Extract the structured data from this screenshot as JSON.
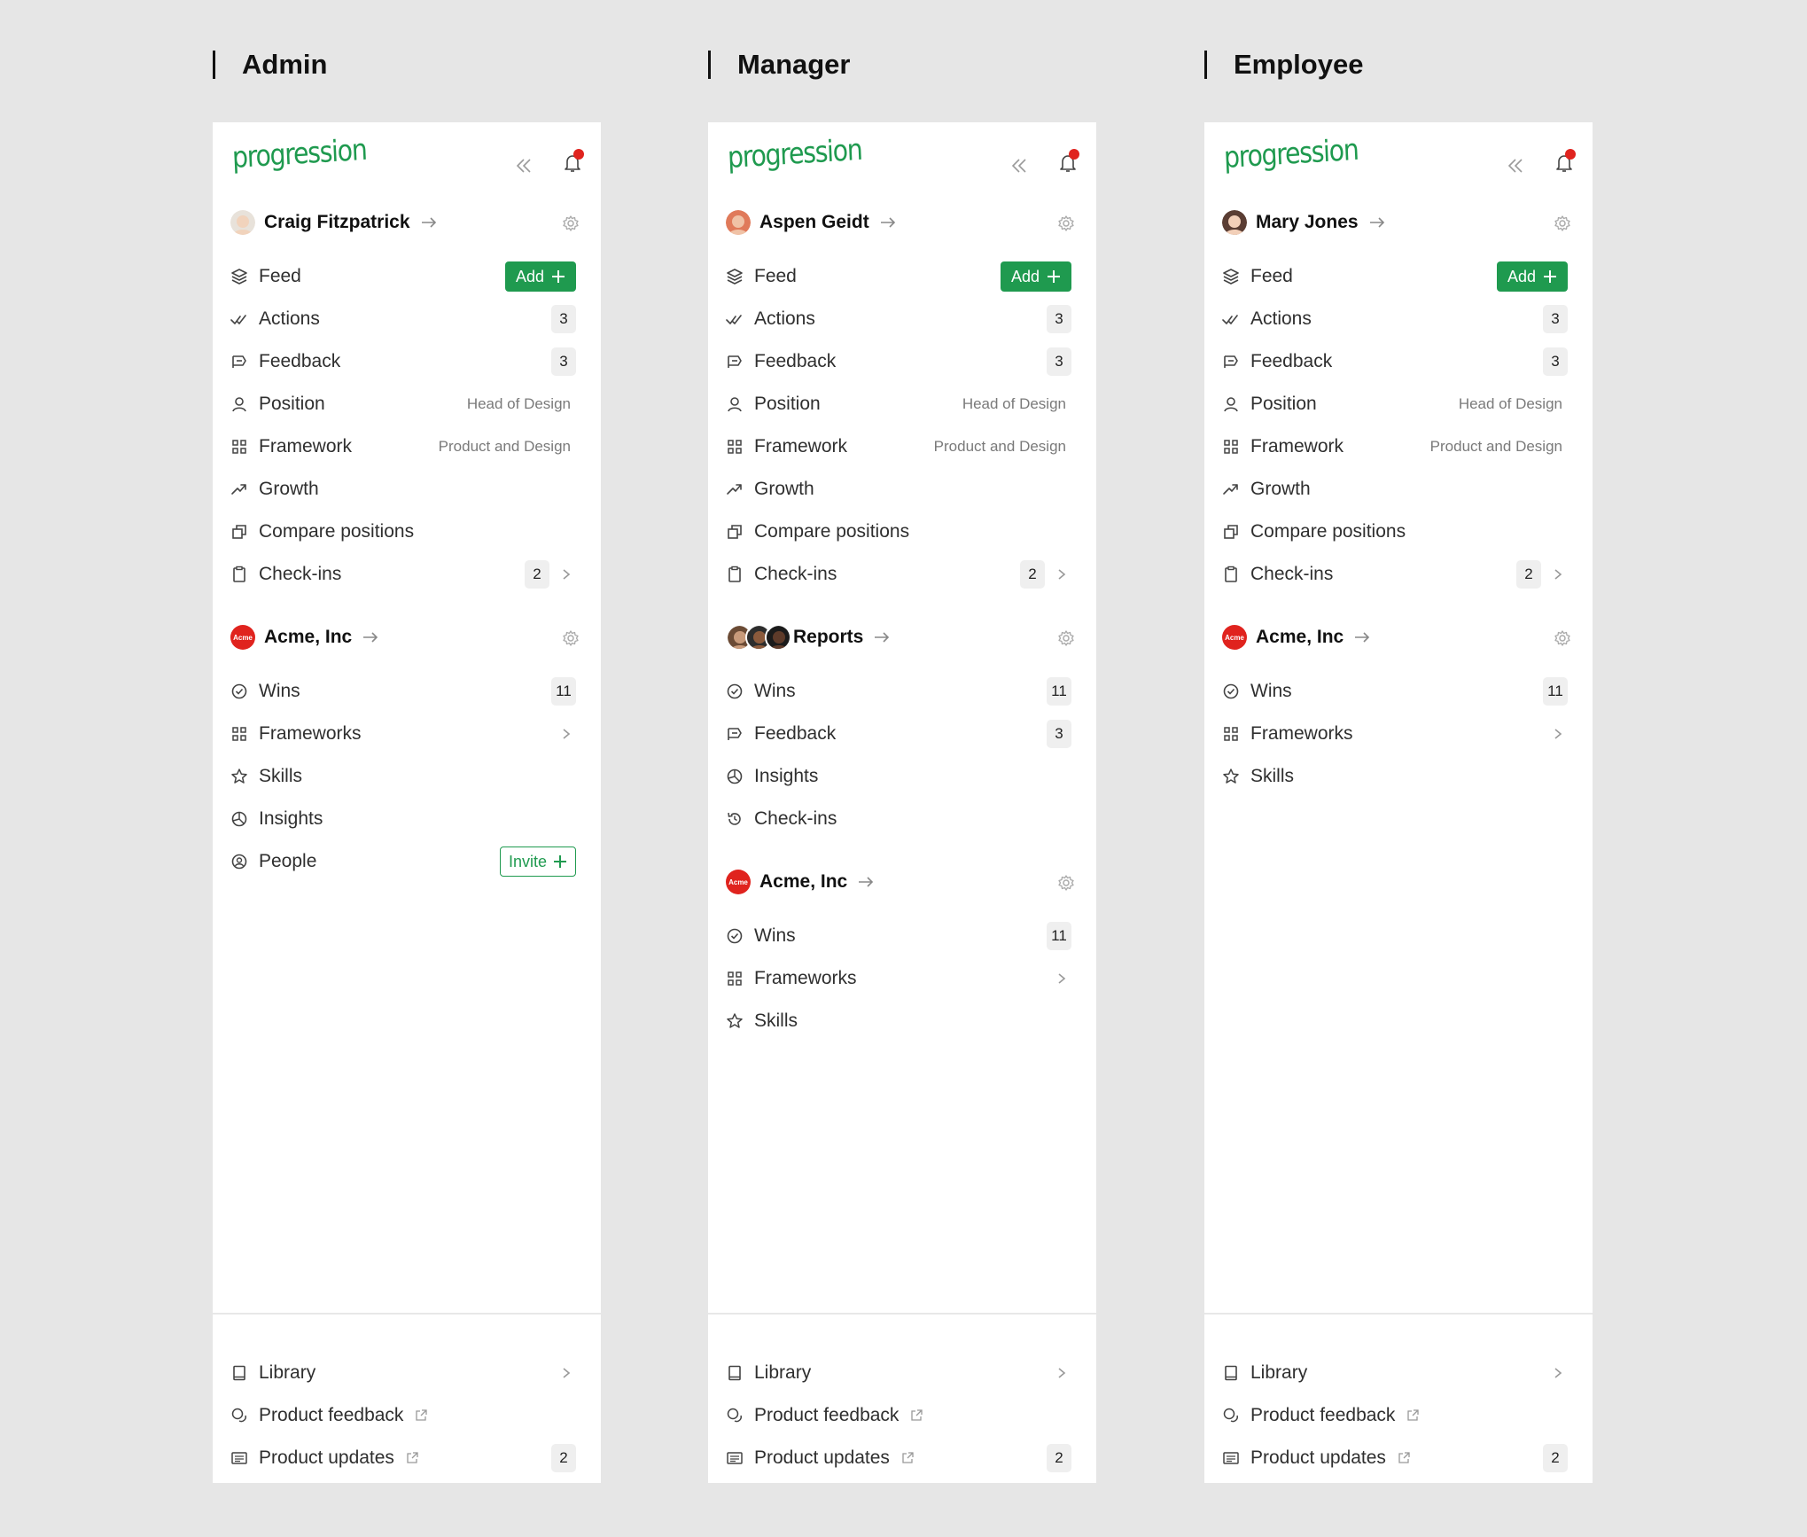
{
  "roles": [
    "Admin",
    "Manager",
    "Employee"
  ],
  "brand": {
    "logo_text": "progression",
    "accent": "#1f9a4f",
    "alert": "#e0231e"
  },
  "admin": {
    "user_name": "Craig Fitzpatrick",
    "top_items": [
      {
        "label": "Feed",
        "button": "Add"
      },
      {
        "label": "Actions",
        "badge": "3"
      },
      {
        "label": "Feedback",
        "badge": "3"
      },
      {
        "label": "Position",
        "meta": "Head of Design"
      },
      {
        "label": "Framework",
        "meta": "Product and Design"
      },
      {
        "label": "Growth"
      },
      {
        "label": "Compare positions"
      },
      {
        "label": "Check-ins",
        "badge": "2"
      }
    ],
    "org_name": "Acme, Inc",
    "org_logo_text": "Acme",
    "org_items": [
      {
        "label": "Wins",
        "badge": "11"
      },
      {
        "label": "Frameworks"
      },
      {
        "label": "Skills"
      },
      {
        "label": "Insights"
      },
      {
        "label": "People",
        "button": "Invite"
      }
    ]
  },
  "manager": {
    "user_name": "Aspen Geidt",
    "top_items": [
      {
        "label": "Feed",
        "button": "Add"
      },
      {
        "label": "Actions",
        "badge": "3"
      },
      {
        "label": "Feedback",
        "badge": "3"
      },
      {
        "label": "Position",
        "meta": "Head of Design"
      },
      {
        "label": "Framework",
        "meta": "Product and Design"
      },
      {
        "label": "Growth"
      },
      {
        "label": "Compare positions"
      },
      {
        "label": "Check-ins",
        "badge": "2"
      }
    ],
    "reports_name": "Reports",
    "reports_items": [
      {
        "label": "Wins",
        "badge": "11"
      },
      {
        "label": "Feedback",
        "badge": "3"
      },
      {
        "label": "Insights"
      },
      {
        "label": "Check-ins"
      }
    ],
    "org_name": "Acme, Inc",
    "org_logo_text": "Acme",
    "org_items": [
      {
        "label": "Wins",
        "badge": "11"
      },
      {
        "label": "Frameworks"
      },
      {
        "label": "Skills"
      }
    ]
  },
  "employee": {
    "user_name": "Mary Jones",
    "top_items": [
      {
        "label": "Feed",
        "button": "Add"
      },
      {
        "label": "Actions",
        "badge": "3"
      },
      {
        "label": "Feedback",
        "badge": "3"
      },
      {
        "label": "Position",
        "meta": "Head of Design"
      },
      {
        "label": "Framework",
        "meta": "Product and Design"
      },
      {
        "label": "Growth"
      },
      {
        "label": "Compare positions"
      },
      {
        "label": "Check-ins",
        "badge": "2"
      }
    ],
    "org_name": "Acme, Inc",
    "org_logo_text": "Acme",
    "org_items": [
      {
        "label": "Wins",
        "badge": "11"
      },
      {
        "label": "Frameworks"
      },
      {
        "label": "Skills"
      }
    ]
  },
  "footer": {
    "library": "Library",
    "product_feedback": "Product feedback",
    "product_updates": "Product updates",
    "updates_badge": "2"
  }
}
